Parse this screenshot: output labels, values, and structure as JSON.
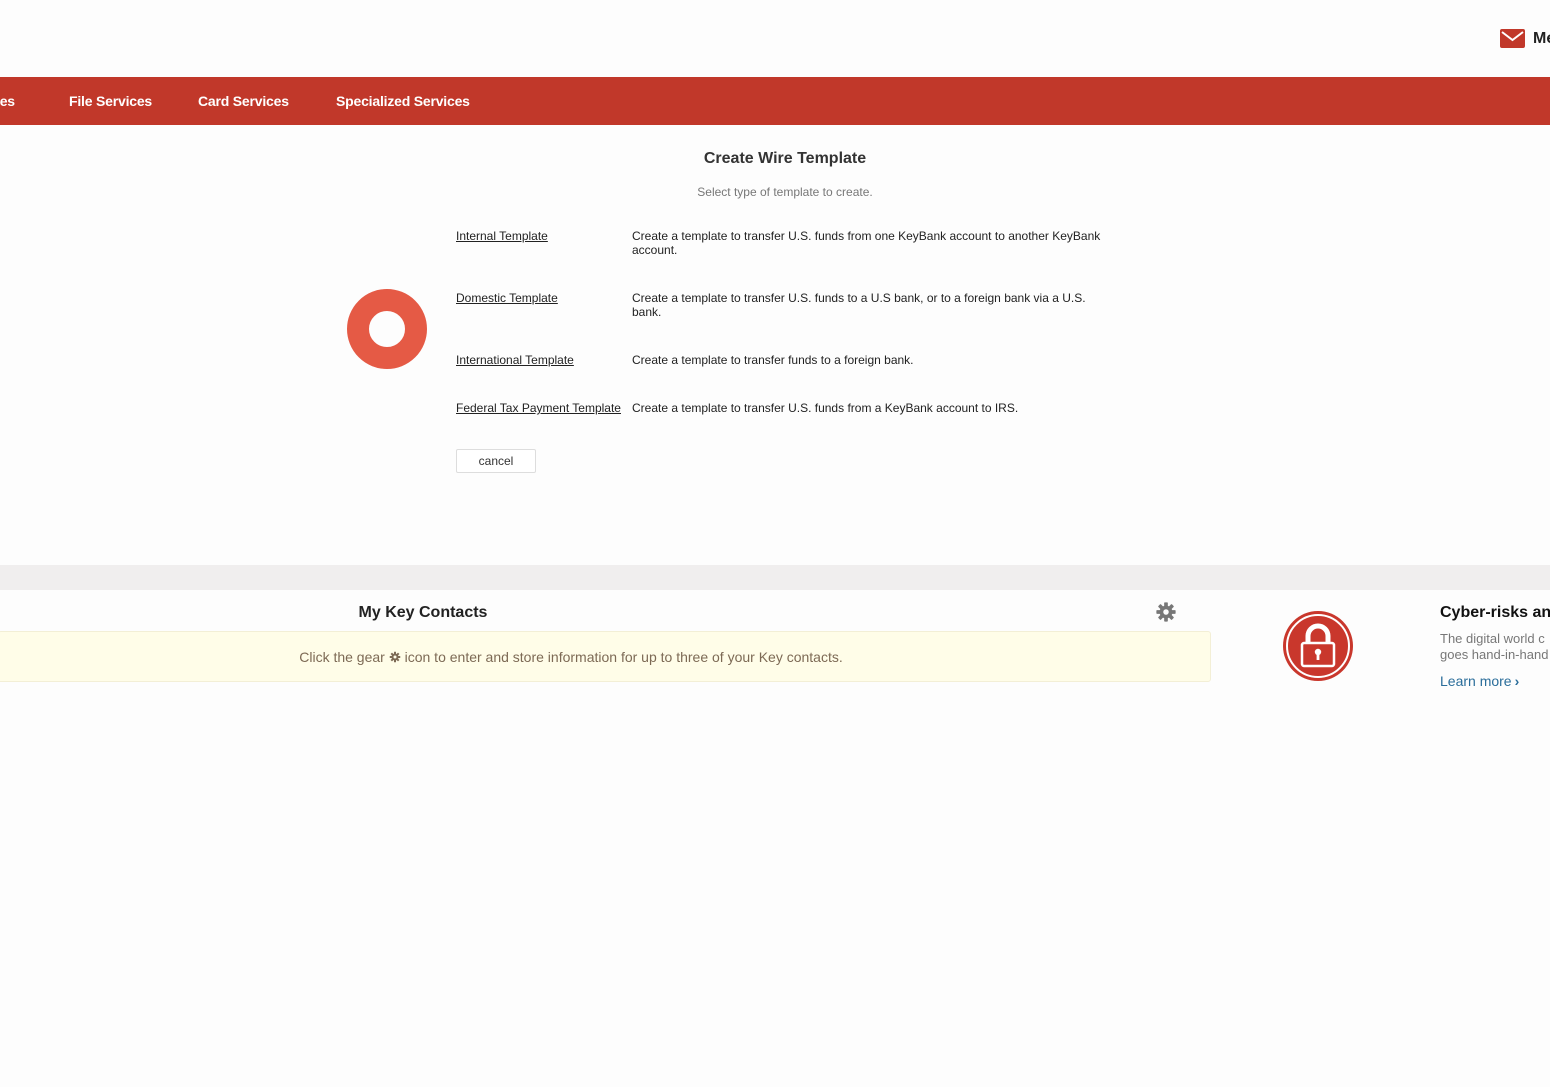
{
  "header": {
    "mail_label": "Me",
    "mail_icon": "envelope-icon",
    "brand_color": "#c1382a"
  },
  "nav": {
    "items": [
      {
        "label": "les"
      },
      {
        "label": "File Services"
      },
      {
        "label": "Card Services"
      },
      {
        "label": "Specialized Services"
      }
    ]
  },
  "main": {
    "title": "Create Wire Template",
    "subtitle": "Select type of template to create.",
    "loading_indicator": "spinner-ring",
    "options": [
      {
        "link": "Internal Template",
        "description": "Create a template to transfer U.S. funds from one KeyBank account to another KeyBank account."
      },
      {
        "link": "Domestic Template",
        "description": "Create a template to transfer U.S. funds to a U.S bank, or to a foreign bank via a U.S. bank."
      },
      {
        "link": "International Template",
        "description": "Create a template to transfer funds to a foreign bank."
      },
      {
        "link": "Federal Tax Payment Template",
        "description": "Create a template to transfer U.S. funds from a KeyBank account to IRS."
      }
    ],
    "cancel_label": "cancel"
  },
  "key_contacts": {
    "title": "My Key Contacts",
    "message_before": "Click the gear",
    "message_after": "icon to enter and store information for up to three of your Key contacts."
  },
  "promo": {
    "title": "Cyber-risks an",
    "body_line1": "The digital world c",
    "body_line2": "goes hand-in-hand",
    "link_label": "Learn more",
    "link_chevron": "›"
  }
}
